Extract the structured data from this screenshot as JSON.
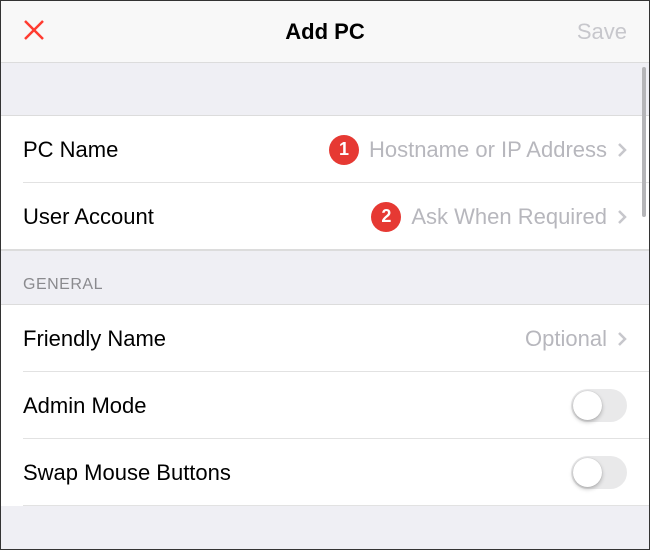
{
  "header": {
    "title": "Add PC",
    "save_label": "Save"
  },
  "rows": {
    "pc_name": {
      "label": "PC Name",
      "placeholder": "Hostname or IP Address",
      "badge": "1"
    },
    "user_account": {
      "label": "User Account",
      "value": "Ask When Required",
      "badge": "2"
    },
    "friendly_name": {
      "label": "Friendly Name",
      "placeholder": "Optional"
    },
    "admin_mode": {
      "label": "Admin Mode"
    },
    "swap_mouse": {
      "label": "Swap Mouse Buttons"
    }
  },
  "sections": {
    "general": "GENERAL"
  }
}
